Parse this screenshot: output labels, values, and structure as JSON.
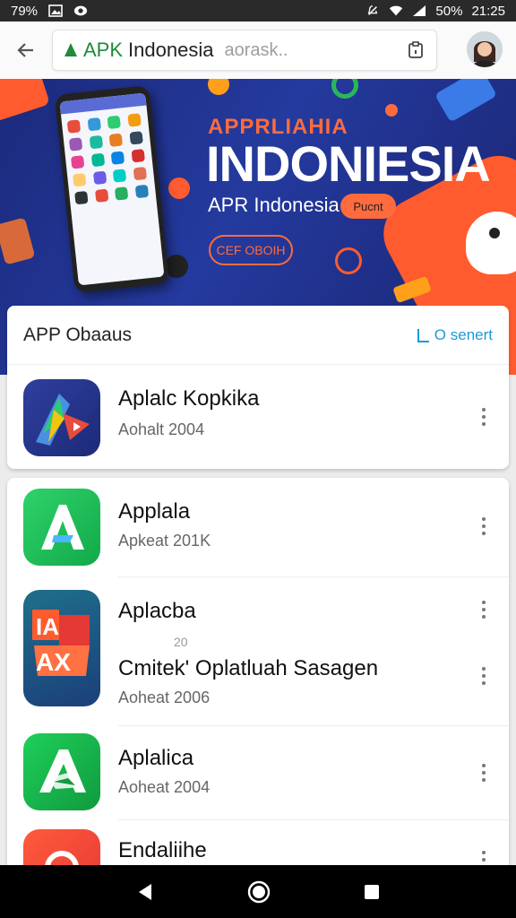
{
  "status_bar": {
    "left_text": "79%",
    "battery": "50%",
    "time": "21:25"
  },
  "browser": {
    "url_site": "APK",
    "url_path": "Indonesia",
    "url_hint": "aorask..",
    "colors": {
      "secure": "#1e8a3a",
      "accent": "#1a9ad6"
    }
  },
  "banner": {
    "eyebrow": "APPRLIAHIA",
    "title": "INDONIESIA",
    "subtitle": "APR Indonesia",
    "pill": "Pucnt",
    "cta": "CEF OBOIH"
  },
  "featured_card": {
    "title": "APP Obaaus",
    "action_label": "O senert",
    "app": {
      "name": "Aplalc Kopkika",
      "subtitle": "Aohalt 2004"
    }
  },
  "app_list": [
    {
      "name": "Applala",
      "subtitle": "Apkeat 201K"
    },
    {
      "name": "Aplacba",
      "subtitle": ""
    },
    {
      "name": "Cmitek' Oplatluah Sasagen",
      "subtitle": "Aoheat 2006",
      "note": "20"
    },
    {
      "name": "Aplalica",
      "subtitle": "Aoheat 2004"
    },
    {
      "name": "Endaliihe",
      "subtitle": ""
    }
  ],
  "icons": [
    "back-arrow-icon",
    "lock-icon",
    "tabs-icon",
    "more-vert-icon",
    "back-triangle-icon",
    "home-circle-icon",
    "recents-square-icon"
  ]
}
